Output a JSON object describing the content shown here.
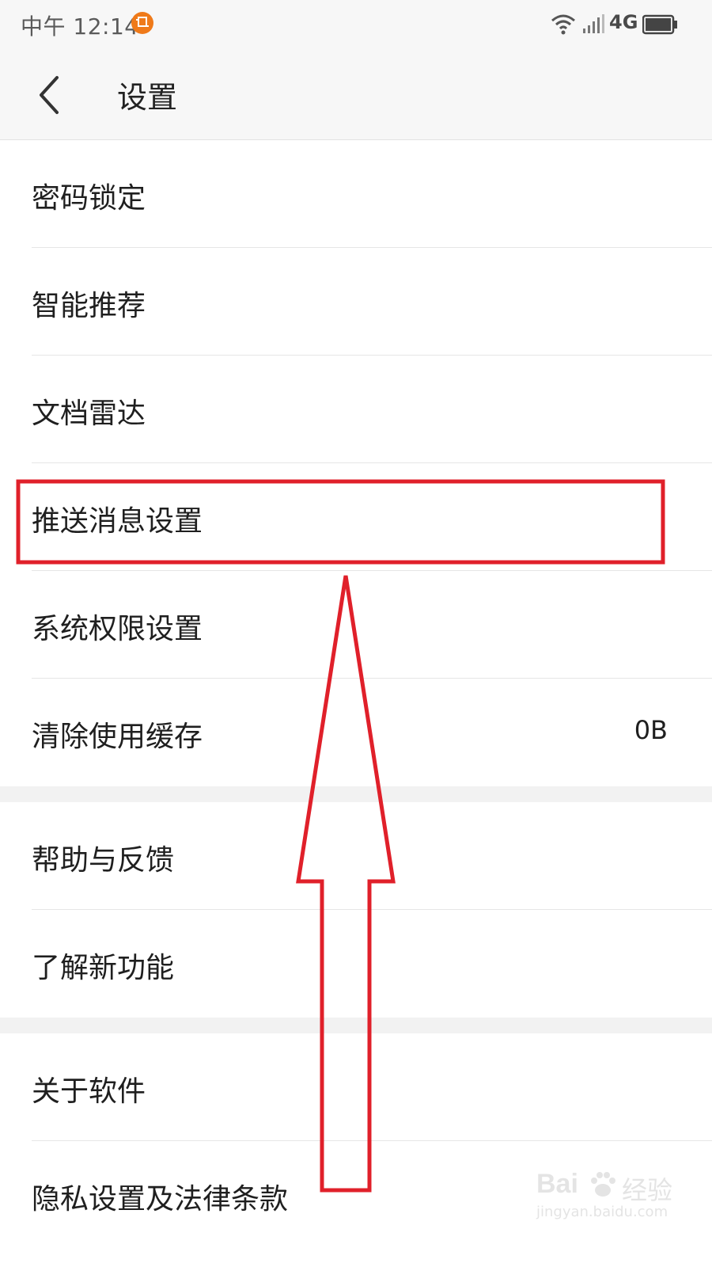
{
  "status_bar": {
    "time": "中午 12:14",
    "network": "4G"
  },
  "header": {
    "title": "设置"
  },
  "settings": {
    "group1": [
      {
        "label": "密码锁定",
        "value": ""
      },
      {
        "label": "智能推荐",
        "value": ""
      },
      {
        "label": "文档雷达",
        "value": ""
      },
      {
        "label": "推送消息设置",
        "value": ""
      },
      {
        "label": "系统权限设置",
        "value": ""
      },
      {
        "label": "清除使用缓存",
        "value": "0B"
      }
    ],
    "group2": [
      {
        "label": "帮助与反馈"
      },
      {
        "label": "了解新功能"
      }
    ],
    "group3": [
      {
        "label": "关于软件"
      },
      {
        "label": "隐私设置及法律条款"
      }
    ]
  },
  "watermark": {
    "brand": "Bai",
    "brand_cn": "经验",
    "url": "jingyan.baidu.com"
  },
  "colors": {
    "annotation_red": "#e0202a",
    "app_badge": "#ef7a1a"
  }
}
